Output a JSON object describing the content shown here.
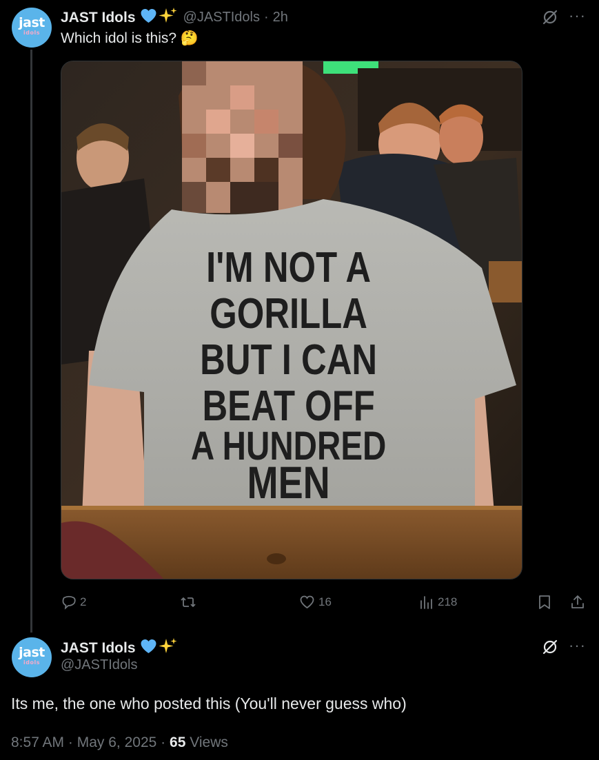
{
  "tweet1": {
    "avatar_text": "jast",
    "avatar_subtext": "idols",
    "name": "JAST Idols",
    "handle": "@JASTIdols",
    "separator": "·",
    "time": "2h",
    "text": "Which idol is this? 🤔",
    "image": {
      "shirt_lines": [
        "I'M NOT A",
        "GORILLA",
        "BUT I CAN",
        "BEAT OFF",
        "A HUNDRED",
        "MEN"
      ]
    },
    "actions": {
      "replies": "2",
      "reposts": "",
      "likes": "16",
      "views": "218"
    }
  },
  "tweet2": {
    "avatar_text": "jast",
    "avatar_subtext": "idols",
    "name": "JAST Idols",
    "handle": "@JASTIdols",
    "text": "Its me, the one who posted this (You'll never guess who)",
    "time": "8:57 AM",
    "dot": "·",
    "date": "May 6, 2025",
    "views_count": "65",
    "views_label": "Views"
  },
  "colors": {
    "background": "#000000",
    "text": "#e7e9ea",
    "muted": "#71767b",
    "verified": "#5eb5f7",
    "sparkle": "#ffd43b",
    "avatar_bg": "#5ab4ea"
  }
}
